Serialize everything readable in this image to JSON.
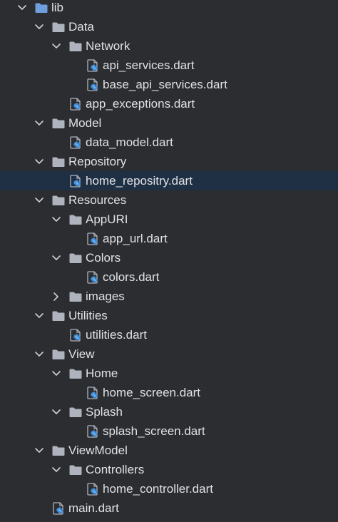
{
  "tree": {
    "items": [
      {
        "label": "lib",
        "type": "folder",
        "depth": 0,
        "expanded": true,
        "chevron": "chevron-down-icon",
        "icon": "folder-icon"
      },
      {
        "label": "Data",
        "type": "folder",
        "depth": 1,
        "expanded": true,
        "chevron": "chevron-down-icon",
        "icon": "folder-icon"
      },
      {
        "label": "Network",
        "type": "folder",
        "depth": 2,
        "expanded": true,
        "chevron": "chevron-down-icon",
        "icon": "folder-icon"
      },
      {
        "label": "api_services.dart",
        "type": "file",
        "depth": 3,
        "icon": "dart-file-icon"
      },
      {
        "label": "base_api_services.dart",
        "type": "file",
        "depth": 3,
        "icon": "dart-file-icon"
      },
      {
        "label": "app_exceptions.dart",
        "type": "file",
        "depth": 2,
        "icon": "dart-file-icon"
      },
      {
        "label": "Model",
        "type": "folder",
        "depth": 1,
        "expanded": true,
        "chevron": "chevron-down-icon",
        "icon": "folder-icon"
      },
      {
        "label": "data_model.dart",
        "type": "file",
        "depth": 2,
        "icon": "dart-file-icon"
      },
      {
        "label": "Repository",
        "type": "folder",
        "depth": 1,
        "expanded": true,
        "chevron": "chevron-down-icon",
        "icon": "folder-icon"
      },
      {
        "label": "home_repositry.dart",
        "type": "file",
        "depth": 2,
        "icon": "dart-file-icon",
        "selected": true
      },
      {
        "label": "Resources",
        "type": "folder",
        "depth": 1,
        "expanded": true,
        "chevron": "chevron-down-icon",
        "icon": "folder-icon"
      },
      {
        "label": "AppURI",
        "type": "folder",
        "depth": 2,
        "expanded": true,
        "chevron": "chevron-down-icon",
        "icon": "folder-icon"
      },
      {
        "label": "app_url.dart",
        "type": "file",
        "depth": 3,
        "icon": "dart-file-icon"
      },
      {
        "label": "Colors",
        "type": "folder",
        "depth": 2,
        "expanded": true,
        "chevron": "chevron-down-icon",
        "icon": "folder-icon"
      },
      {
        "label": "colors.dart",
        "type": "file",
        "depth": 3,
        "icon": "dart-file-icon"
      },
      {
        "label": "images",
        "type": "folder",
        "depth": 2,
        "expanded": false,
        "chevron": "chevron-right-icon",
        "icon": "folder-icon"
      },
      {
        "label": "Utilities",
        "type": "folder",
        "depth": 1,
        "expanded": true,
        "chevron": "chevron-down-icon",
        "icon": "folder-icon"
      },
      {
        "label": "utilities.dart",
        "type": "file",
        "depth": 2,
        "icon": "dart-file-icon"
      },
      {
        "label": "View",
        "type": "folder",
        "depth": 1,
        "expanded": true,
        "chevron": "chevron-down-icon",
        "icon": "folder-icon"
      },
      {
        "label": "Home",
        "type": "folder",
        "depth": 2,
        "expanded": true,
        "chevron": "chevron-down-icon",
        "icon": "folder-icon"
      },
      {
        "label": "home_screen.dart",
        "type": "file",
        "depth": 3,
        "icon": "dart-file-icon"
      },
      {
        "label": "Splash",
        "type": "folder",
        "depth": 2,
        "expanded": true,
        "chevron": "chevron-down-icon",
        "icon": "folder-icon"
      },
      {
        "label": "splash_screen.dart",
        "type": "file",
        "depth": 3,
        "icon": "dart-file-icon"
      },
      {
        "label": "ViewModel",
        "type": "folder",
        "depth": 1,
        "expanded": true,
        "chevron": "chevron-down-icon",
        "icon": "folder-icon"
      },
      {
        "label": "Controllers",
        "type": "folder",
        "depth": 2,
        "expanded": true,
        "chevron": "chevron-down-icon",
        "icon": "folder-icon"
      },
      {
        "label": "home_controller.dart",
        "type": "file",
        "depth": 3,
        "icon": "dart-file-icon"
      },
      {
        "label": "main.dart",
        "type": "file",
        "depth": 1,
        "icon": "dart-file-icon"
      }
    ]
  },
  "colors": {
    "background": "#2b2d30",
    "selection": "#1f3044",
    "text": "#dfe1e5",
    "chevron": "#ced0d6",
    "folder": "#aeb3bd",
    "folder_lib": "#6e9fdc",
    "dart_page": "#aeb3bd",
    "dart_badge": "#3d8bd6"
  }
}
